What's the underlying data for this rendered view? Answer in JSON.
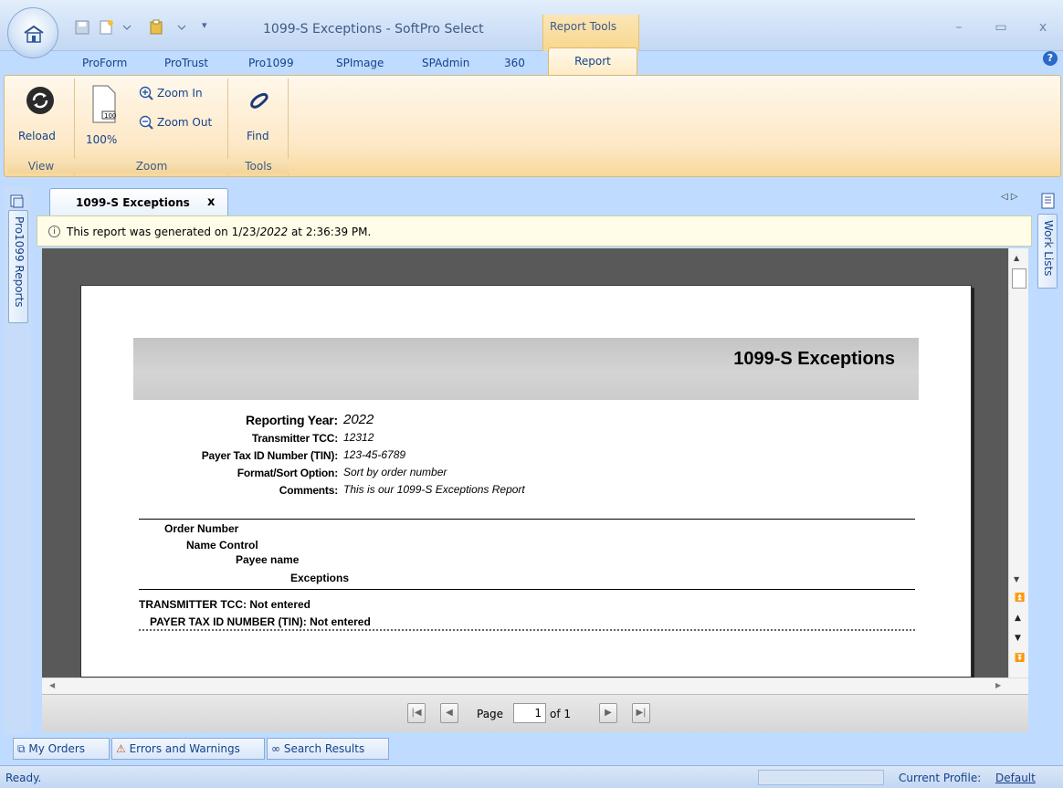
{
  "window": {
    "title": "1099-S Exceptions - SoftPro Select",
    "context_tab_group": "Report Tools"
  },
  "ribbon_tabs": [
    "ProForm",
    "ProTrust",
    "Pro1099",
    "SPImage",
    "SPAdmin",
    "360",
    "Report"
  ],
  "ribbon": {
    "view": {
      "label": "View",
      "reload": "Reload"
    },
    "zoom": {
      "label": "Zoom",
      "hundred": "100%",
      "zoom_in": "Zoom In",
      "zoom_out": "Zoom Out",
      "icon_text": "100"
    },
    "tools": {
      "label": "Tools",
      "find": "Find"
    }
  },
  "side_panels": {
    "left": "Pro1099 Reports",
    "right": "Work Lists"
  },
  "document_tab": {
    "label": "1099-S Exceptions",
    "close": "x"
  },
  "info_bar": {
    "text_prefix": "This report was generated on 1/23/",
    "year": "2022",
    "text_suffix": " at 2:36:39 PM."
  },
  "report": {
    "title": "1099-S Exceptions",
    "fields": [
      {
        "label": "Reporting Year:",
        "value": "2022"
      },
      {
        "label": "Transmitter TCC:",
        "value": "12312"
      },
      {
        "label": "Payer Tax ID Number (TIN):",
        "value": "123-45-6789"
      },
      {
        "label": "Format/Sort Option:",
        "value": "Sort by order number"
      },
      {
        "label": "Comments:",
        "value": "This is our 1099-S Exceptions Report"
      }
    ],
    "columns": {
      "order_number": "Order Number",
      "name_control": "Name Control",
      "payee_name": "Payee name",
      "exceptions": "Exceptions"
    },
    "exceptions": {
      "line1": "TRANSMITTER TCC: Not entered",
      "line2": "PAYER TAX ID NUMBER (TIN): Not entered"
    }
  },
  "pager": {
    "page_label": "Page",
    "page_value": "1",
    "of_label": "of 1"
  },
  "bottom_tabs": [
    "My Orders",
    "Errors and Warnings",
    "Search Results"
  ],
  "status": {
    "text": "Ready.",
    "profile_label": "Current Profile:",
    "profile_value": "Default"
  }
}
